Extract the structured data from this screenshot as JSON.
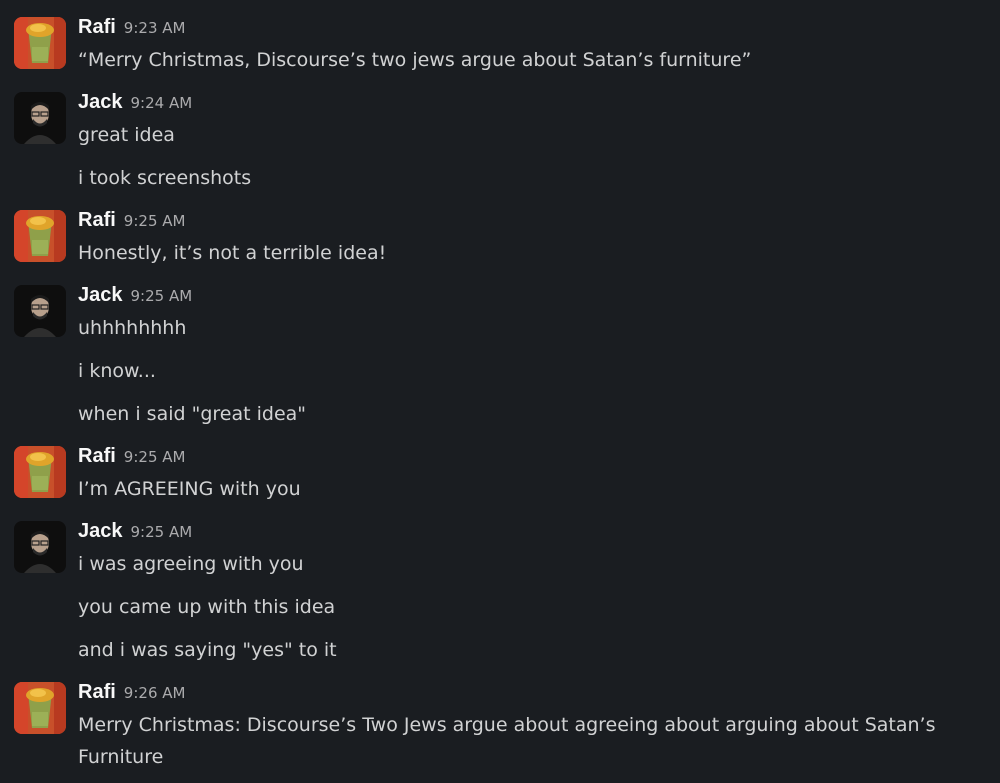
{
  "messages": [
    {
      "author": "Rafi",
      "time": "9:23 AM",
      "avatar_icon": "drink-photo-icon",
      "lines": [
        "“Merry Christmas, Discourse’s two jews argue about Satan’s furniture”"
      ]
    },
    {
      "author": "Jack",
      "time": "9:24 AM",
      "avatar_icon": "person-photo-icon",
      "lines": [
        "great idea",
        "i took screenshots"
      ]
    },
    {
      "author": "Rafi",
      "time": "9:25 AM",
      "avatar_icon": "drink-photo-icon",
      "lines": [
        "Honestly, it’s not a terrible idea!"
      ]
    },
    {
      "author": "Jack",
      "time": "9:25 AM",
      "avatar_icon": "person-photo-icon",
      "lines": [
        "uhhhhhhhh",
        "i know...",
        "when i said \"great idea\""
      ]
    },
    {
      "author": "Rafi",
      "time": "9:25 AM",
      "avatar_icon": "drink-photo-icon",
      "lines": [
        "I’m AGREEING with you"
      ]
    },
    {
      "author": "Jack",
      "time": "9:25 AM",
      "avatar_icon": "person-photo-icon",
      "lines": [
        "i was agreeing with you",
        "you came up with this idea",
        "and i was saying \"yes\" to it"
      ]
    },
    {
      "author": "Rafi",
      "time": "9:26 AM",
      "avatar_icon": "drink-photo-icon",
      "lines": [
        "Merry Christmas: Discourse’s Two Jews argue about agreeing about arguing about Satan’s Furniture"
      ]
    }
  ],
  "colors": {
    "background": "#1a1d21",
    "author": "#f8f8f8",
    "timestamp": "#ababad",
    "text": "#d1d2d3"
  }
}
